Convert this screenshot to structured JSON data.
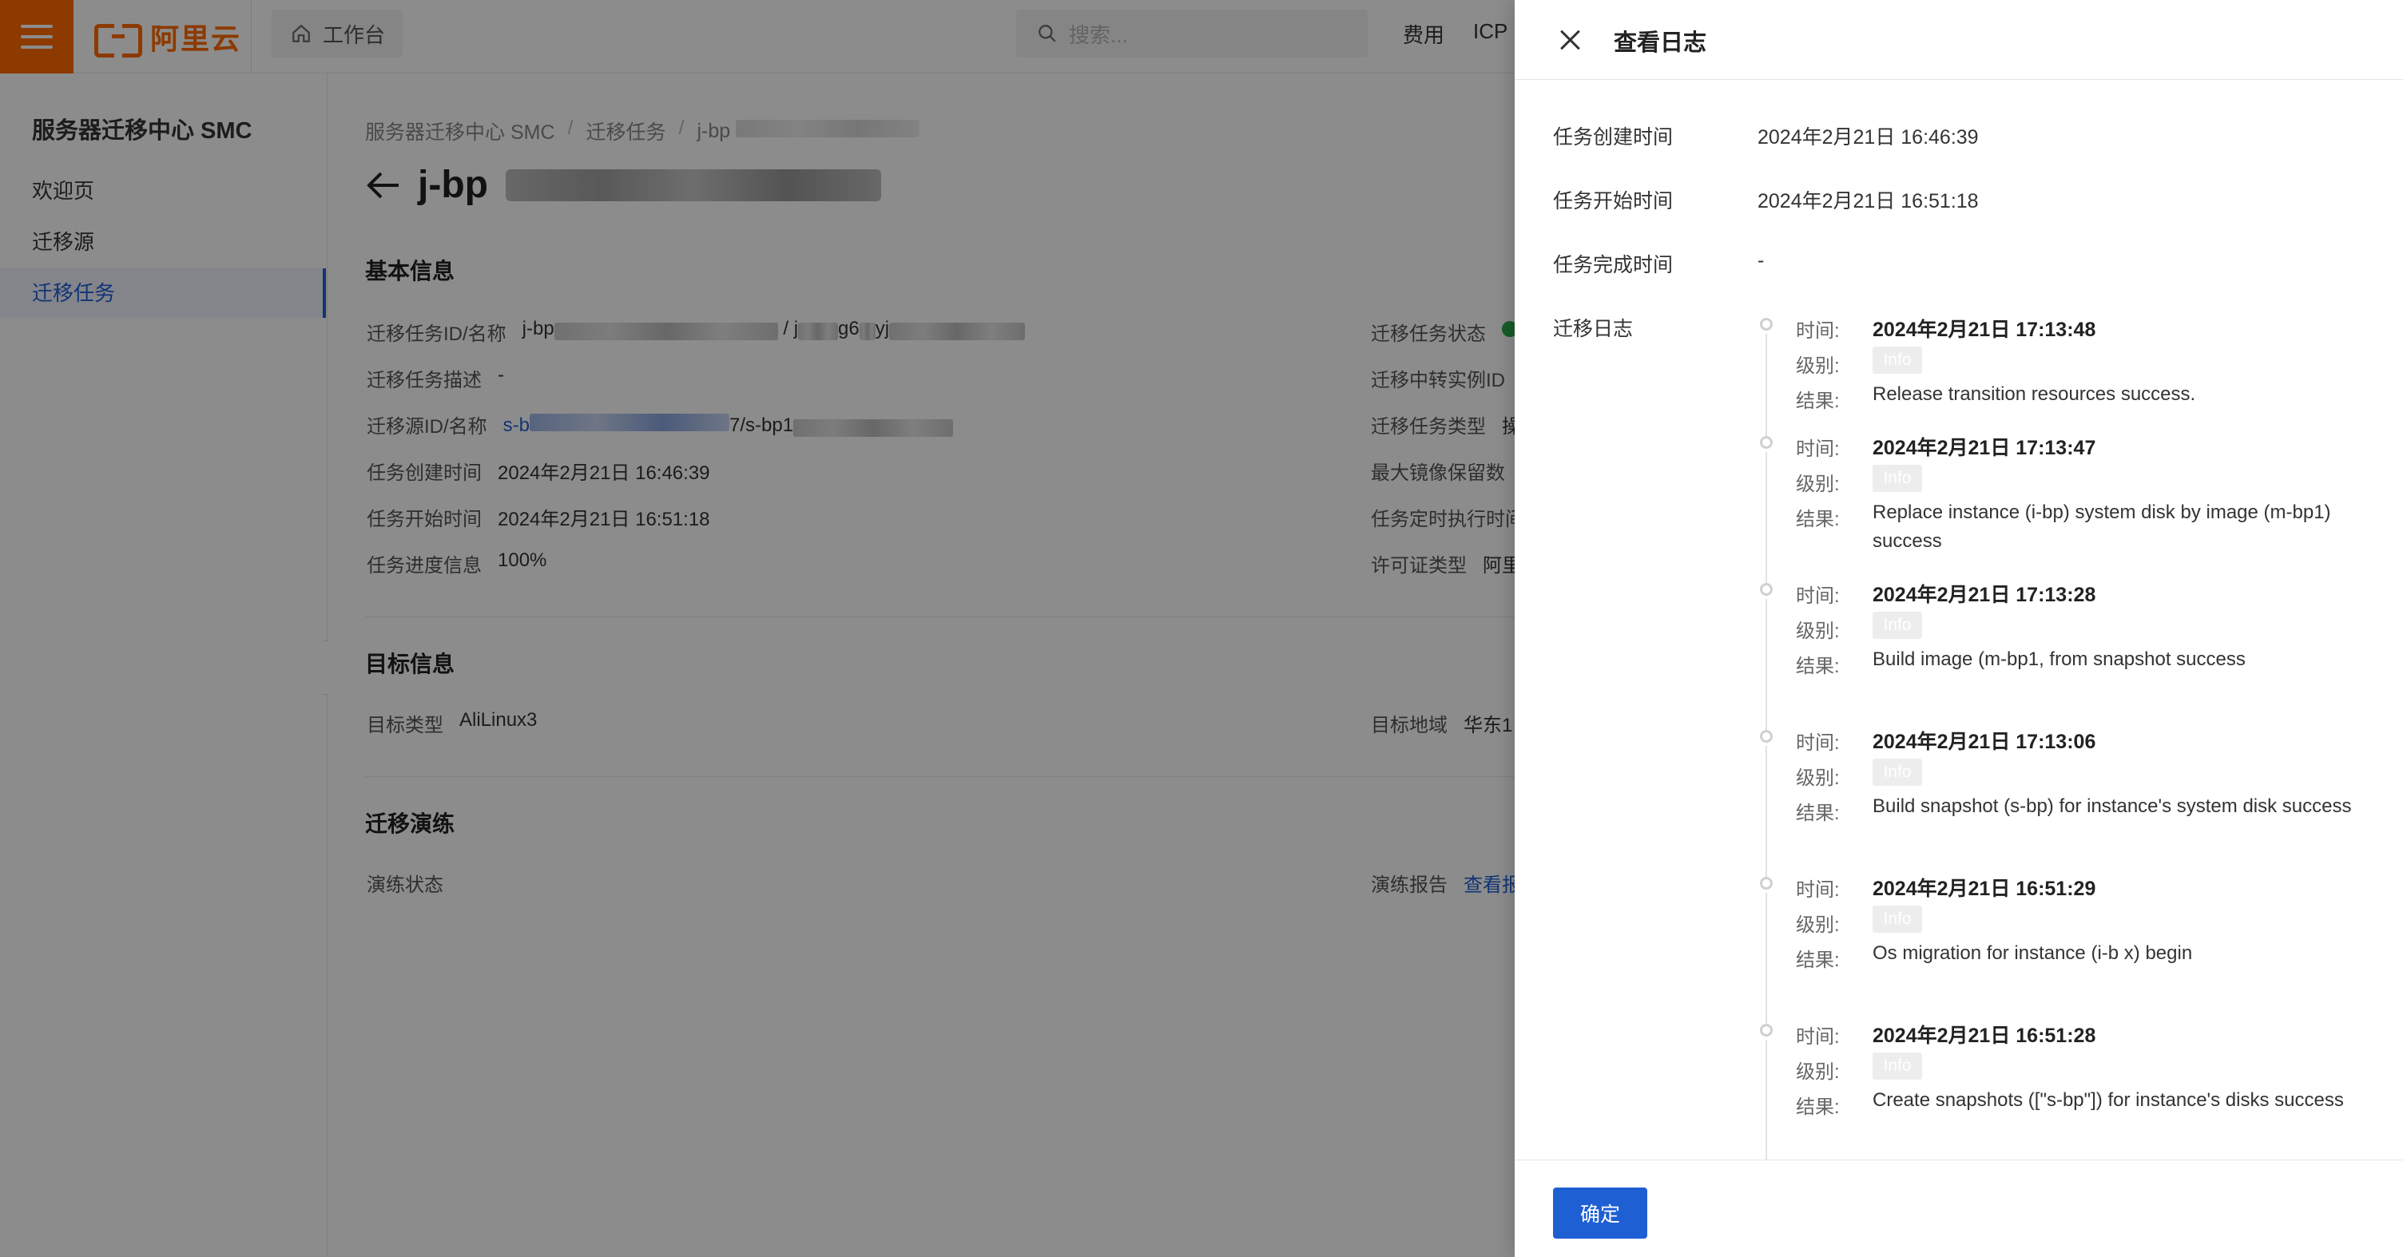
{
  "topbar": {
    "logo_text": "阿里云",
    "workbench": "工作台",
    "search_placeholder": "搜索...",
    "links": [
      "费用",
      "ICP"
    ]
  },
  "sidebar": {
    "title": "服务器迁移中心 SMC",
    "items": [
      {
        "label": "欢迎页",
        "active": false
      },
      {
        "label": "迁移源",
        "active": false
      },
      {
        "label": "迁移任务",
        "active": true
      }
    ]
  },
  "main": {
    "breadcrumb": [
      "服务器迁移中心 SMC",
      "迁移任务",
      "j-bp"
    ],
    "page_title": "j-bp",
    "basic_info_title": "基本信息",
    "basic_left": [
      {
        "label": "迁移任务ID/名称",
        "value": "j-bp",
        "value2": "/ j",
        "value3": "g6",
        "value4": "yj"
      },
      {
        "label": "迁移任务描述",
        "value": "-"
      },
      {
        "label": "迁移源ID/名称",
        "value": "s-b",
        "value2": "7/s-bp1"
      },
      {
        "label": "任务创建时间",
        "value": "2024年2月21日 16:46:39"
      },
      {
        "label": "任务开始时间",
        "value": "2024年2月21日 16:51:18"
      },
      {
        "label": "任务进度信息",
        "value": "100%"
      }
    ],
    "basic_right": [
      {
        "label": "迁移任务状态"
      },
      {
        "label": "迁移中转实例ID"
      },
      {
        "label": "迁移任务类型",
        "value": "操"
      },
      {
        "label": "最大镜像保留数"
      },
      {
        "label": "任务定时执行时间"
      },
      {
        "label": "许可证类型",
        "value": "阿里"
      }
    ],
    "target_title": "目标信息",
    "target_left": {
      "label": "目标类型",
      "value": "AliLinux3"
    },
    "target_right": {
      "label": "目标地域",
      "value": "华东1"
    },
    "drill_title": "迁移演练",
    "drill_left": {
      "label": "演练状态"
    },
    "drill_right": {
      "label": "演练报告",
      "value": "查看报"
    }
  },
  "drawer": {
    "title": "查看日志",
    "fields": [
      {
        "label": "任务创建时间",
        "value": "2024年2月21日 16:46:39"
      },
      {
        "label": "任务开始时间",
        "value": "2024年2月21日 16:51:18"
      },
      {
        "label": "任务完成时间",
        "value": "-"
      }
    ],
    "log_label": "迁移日志",
    "key_time": "时间:",
    "key_level": "级别:",
    "key_result": "结果:",
    "logs": [
      {
        "time": "2024年2月21日 17:13:48",
        "level": "Info",
        "result": "Release transition resources success."
      },
      {
        "time": "2024年2月21日 17:13:47",
        "level": "Info",
        "result": "Replace instance (i-bp) system disk by image (m-bp1) success"
      },
      {
        "time": "2024年2月21日 17:13:28",
        "level": "Info",
        "result": "Build image (m-bp1, from snapshot success"
      },
      {
        "time": "2024年2月21日 17:13:06",
        "level": "Info",
        "result": "Build snapshot (s-bp) for instance's system disk success"
      },
      {
        "time": "2024年2月21日 16:51:29",
        "level": "Info",
        "result": "Os migration for instance (i-b x) begin"
      },
      {
        "time": "2024年2月21日 16:51:28",
        "level": "Info",
        "result": "Create snapshots ([\"s-bp\"]) for instance's disks success"
      }
    ],
    "ok_button": "确定"
  },
  "colors": {
    "brand": "#ff6a00",
    "primary": "#1f5fd4",
    "success": "#2ba84a"
  }
}
